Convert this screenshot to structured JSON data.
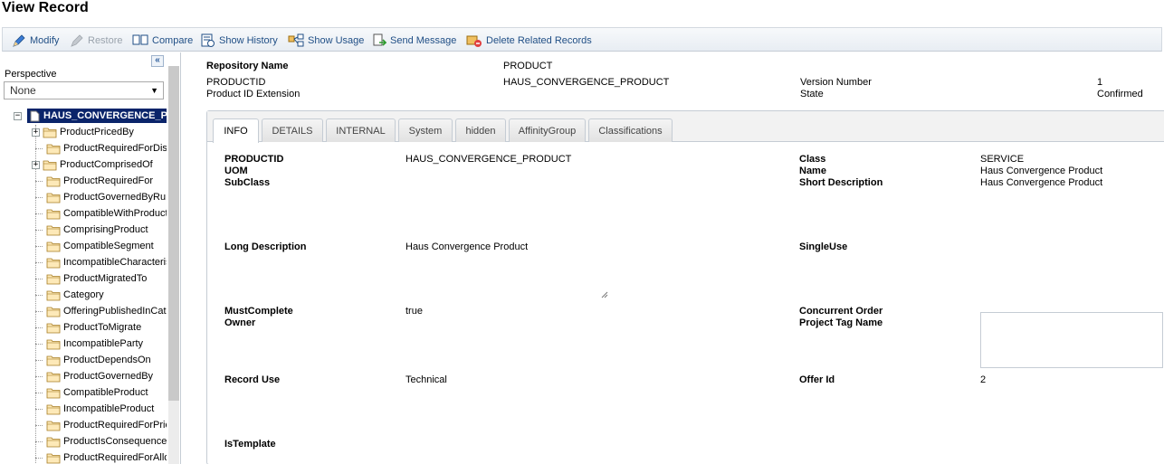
{
  "page_title": "View Record",
  "toolbar": {
    "modify": "Modify",
    "restore": "Restore",
    "compare": "Compare",
    "show_history": "Show History",
    "show_usage": "Show Usage",
    "send_message": "Send Message",
    "delete_related": "Delete Related Records"
  },
  "left": {
    "collapse": "«",
    "perspective_label": "Perspective",
    "perspective_value": "None",
    "root": "HAUS_CONVERGENCE_P",
    "items": [
      "ProductPricedBy",
      "ProductRequiredForDis",
      "ProductComprisedOf",
      "ProductRequiredFor",
      "ProductGovernedByRu",
      "CompatibleWithProduct",
      "ComprisingProduct",
      "CompatibleSegment",
      "IncompatibleCharacteris",
      "ProductMigratedTo",
      "Category",
      "OfferingPublishedInCata",
      "ProductToMigrate",
      "IncompatibleParty",
      "ProductDependsOn",
      "ProductGovernedBy",
      "CompatibleProduct",
      "IncompatibleProduct",
      "ProductRequiredForPric",
      "ProductIsConsequence",
      "ProductRequiredForAllo"
    ]
  },
  "header": {
    "repo_label": "Repository Name",
    "repo_value": "PRODUCT",
    "productid_label": "PRODUCTID",
    "productid_value": "HAUS_CONVERGENCE_PRODUCT",
    "ext_label": "Product ID Extension",
    "version_label": "Version Number",
    "version_value": "1",
    "state_label": "State",
    "state_value": "Confirmed"
  },
  "tabs": [
    "INFO",
    "DETAILS",
    "INTERNAL",
    "System",
    "hidden",
    "AffinityGroup",
    "Classifications"
  ],
  "info": {
    "productid_label": "PRODUCTID",
    "productid_value": "HAUS_CONVERGENCE_PRODUCT",
    "uom_label": "UOM",
    "subclass_label": "SubClass",
    "class_label": "Class",
    "class_value": "SERVICE",
    "name_label": "Name",
    "name_value": "Haus Convergence Product",
    "short_desc_label": "Short Description",
    "short_desc_value": "Haus Convergence Product",
    "long_desc_label": "Long Description",
    "long_desc_value": "Haus Convergence Product",
    "single_use_label": "SingleUse",
    "must_complete_label": "MustComplete",
    "must_complete_value": "true",
    "owner_label": "Owner",
    "concurrent_label": "Concurrent Order",
    "project_tag_label": "Project Tag Name",
    "record_use_label": "Record Use",
    "record_use_value": "Technical",
    "offer_id_label": "Offer Id",
    "offer_id_value": "2",
    "is_template_label": "IsTemplate"
  }
}
